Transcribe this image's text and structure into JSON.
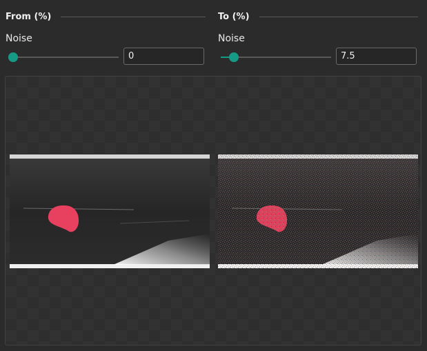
{
  "from": {
    "title": "From (%)",
    "noise_label": "Noise",
    "noise_value": "0",
    "noise_fraction": 0.0
  },
  "to": {
    "title": "To (%)",
    "noise_label": "Noise",
    "noise_value": "7.5",
    "noise_fraction": 0.075
  },
  "colors": {
    "accent": "#179a85",
    "background": "#2b2b2b",
    "blob": "#e8405f"
  },
  "preview": {
    "items": [
      "from-preview-image",
      "to-preview-image"
    ]
  }
}
